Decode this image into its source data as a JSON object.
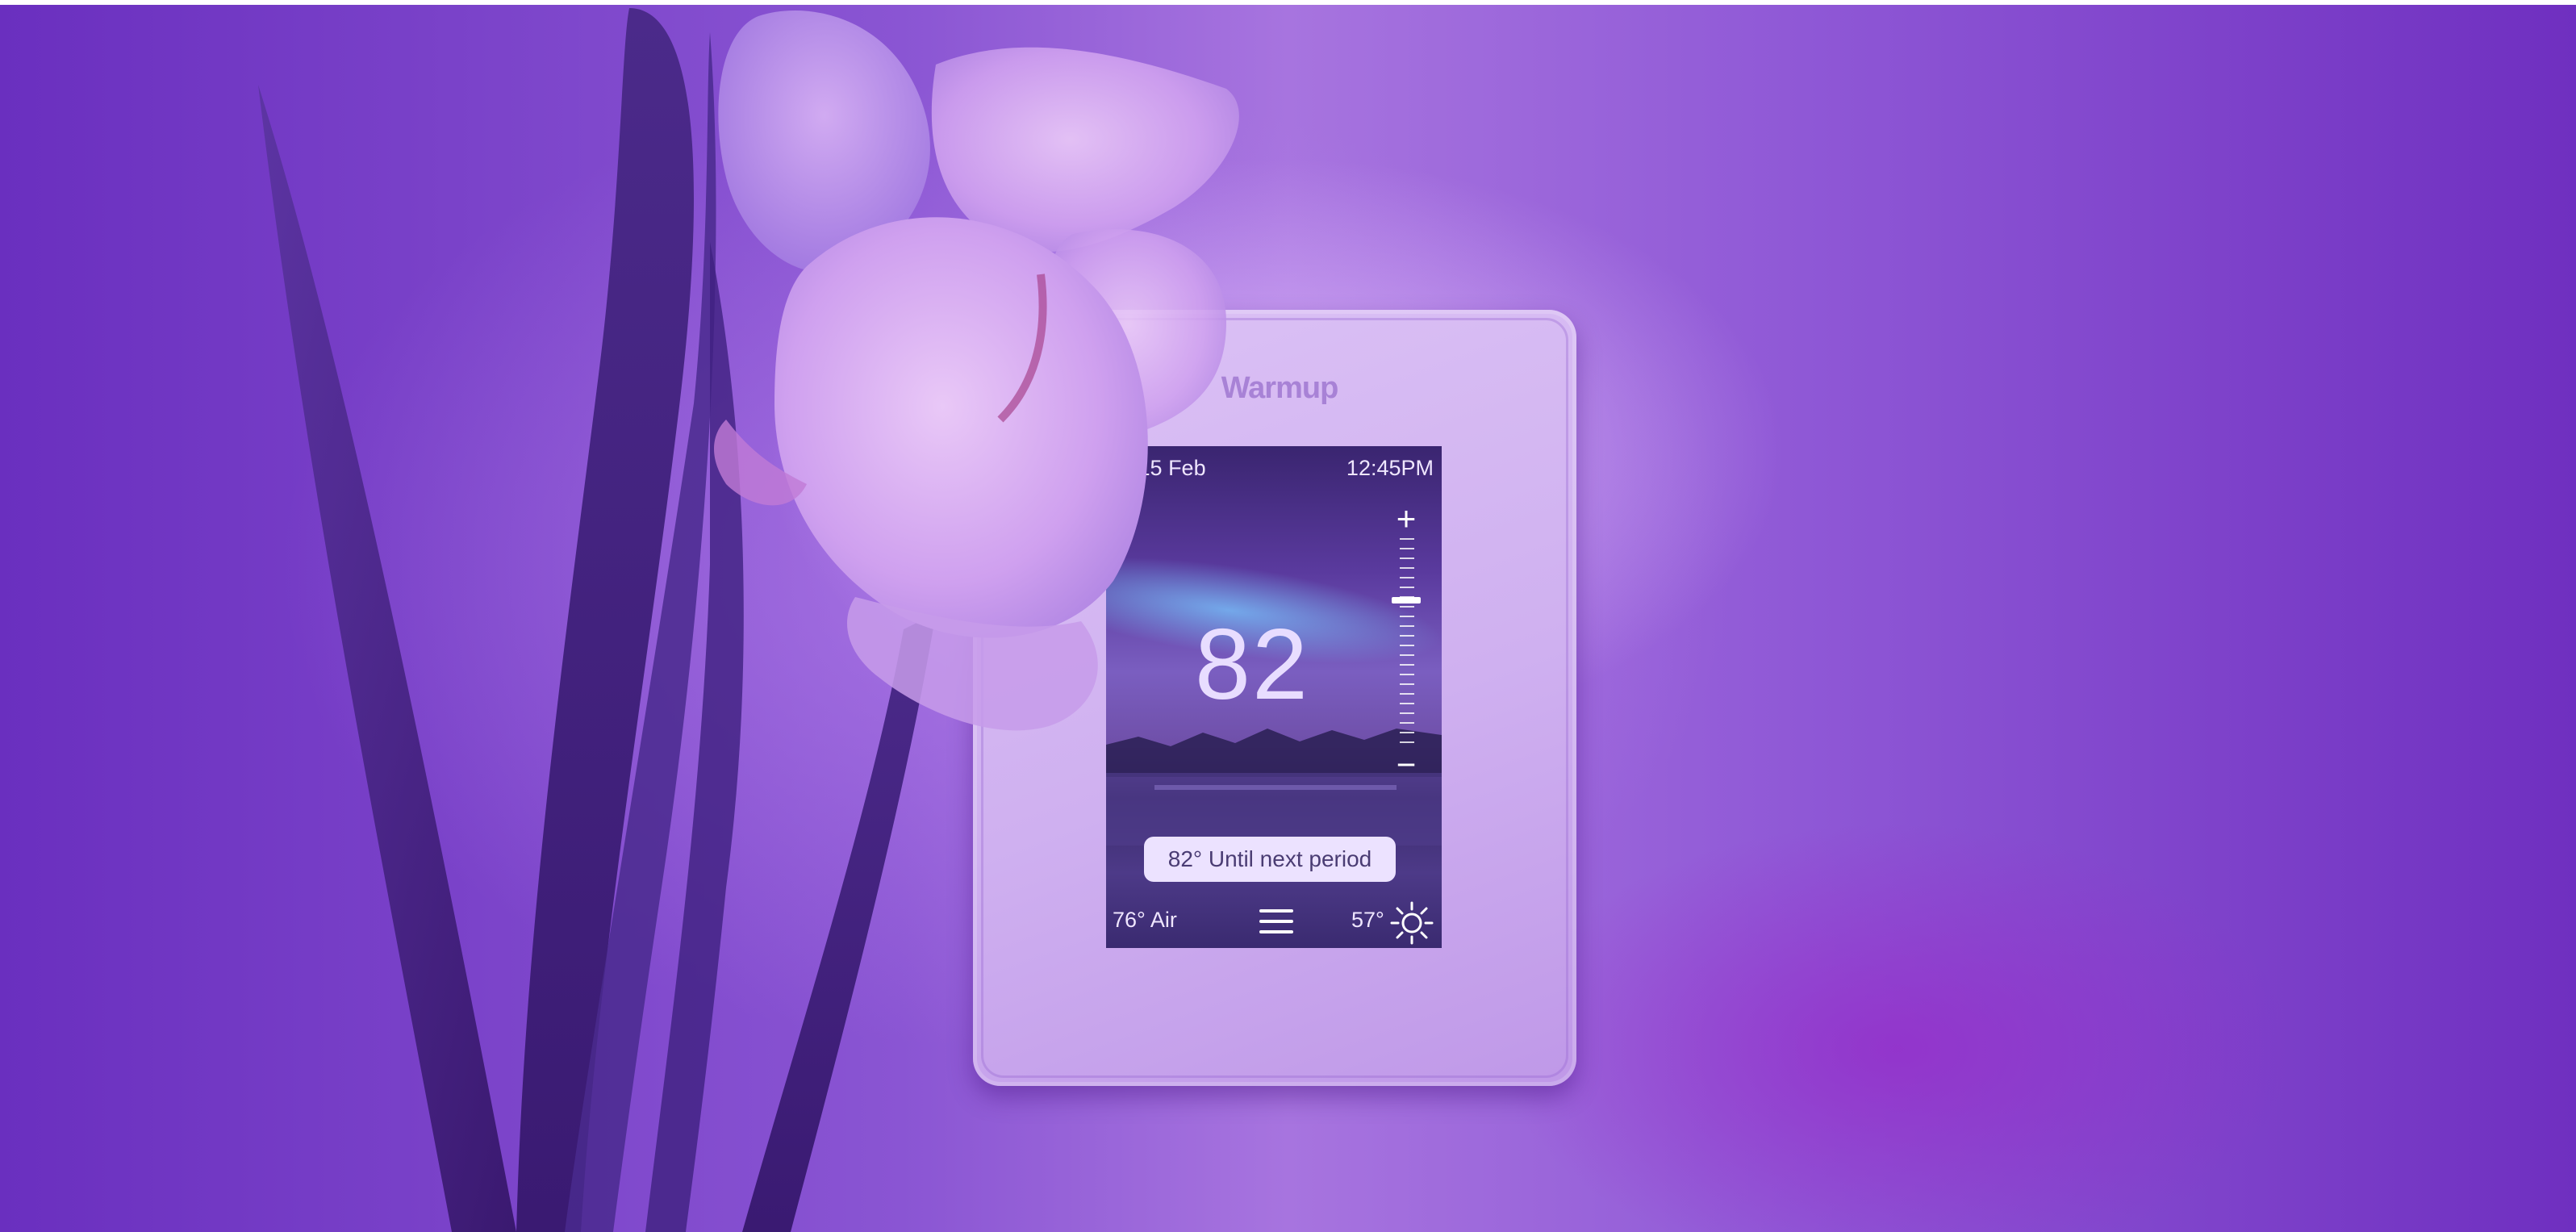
{
  "device": {
    "brand": "Warmup",
    "screen": {
      "date": "ed 15 Feb",
      "time": "12:45PM",
      "setpoint": "82",
      "hold_message": "82° Until next period",
      "air_temp": "76° Air",
      "outside_temp": "57°",
      "slider_plus": "+",
      "slider_minus": "−"
    }
  },
  "colors": {
    "background": "#7a3fc8",
    "device_body": "#d6bbf3",
    "screen_text": "#efe6ff",
    "pill_bg": "#ece2ff",
    "pill_text": "#4a3c73"
  },
  "icons": {
    "menu": "hamburger-menu-icon",
    "weather": "sun-icon"
  }
}
